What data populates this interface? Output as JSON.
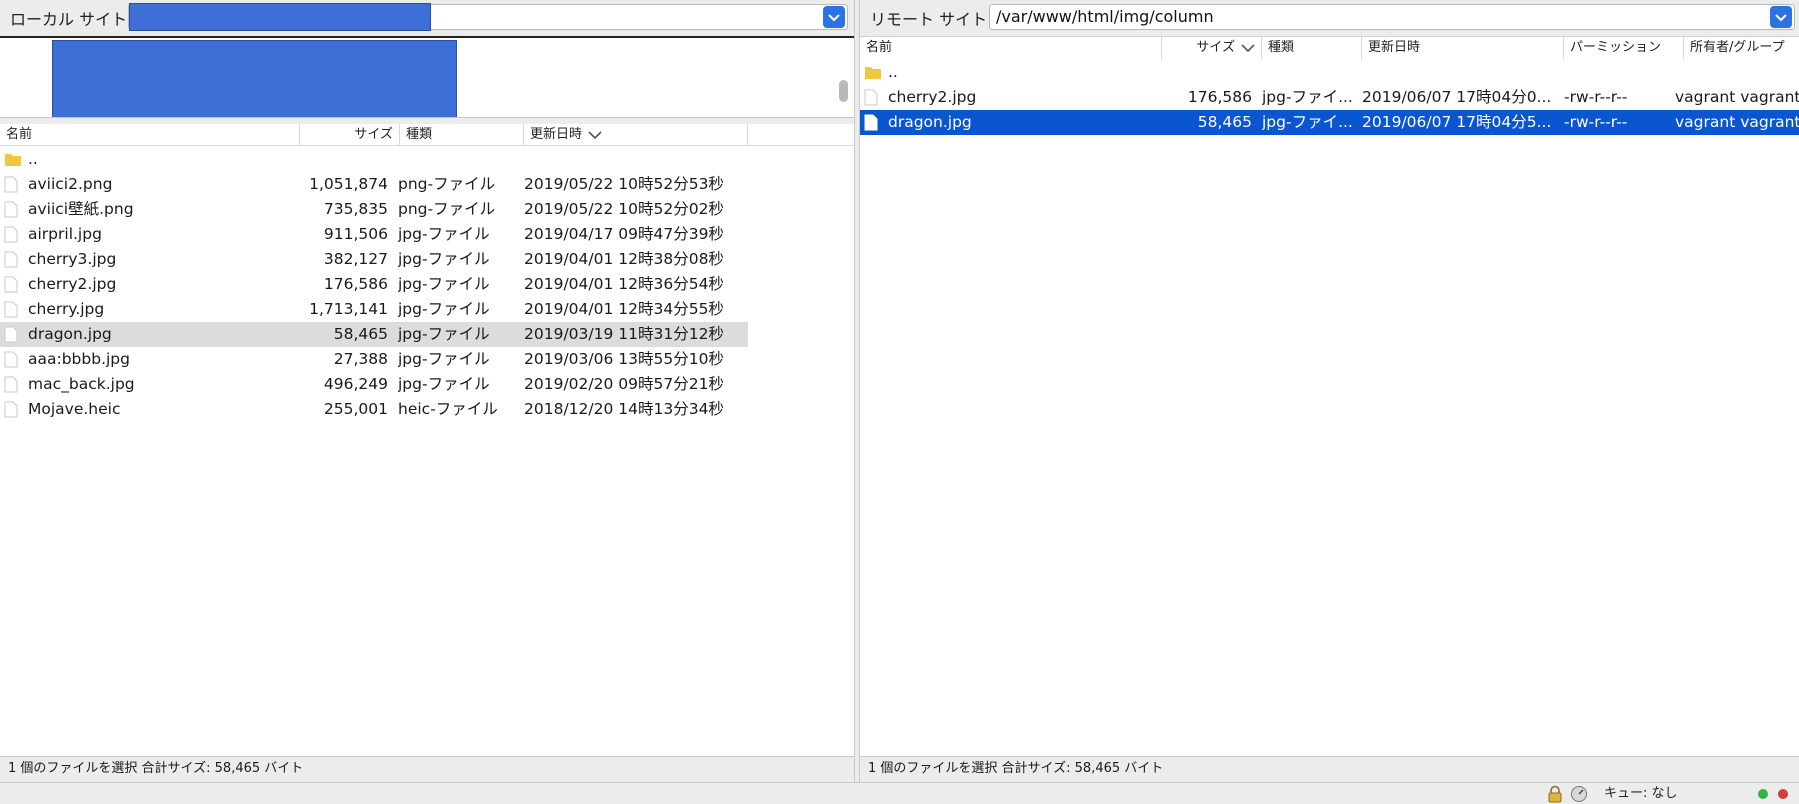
{
  "local": {
    "site_label": "ローカル サイト:",
    "site_value": "",
    "columns": [
      "名前",
      "サイズ",
      "種類",
      "更新日時"
    ],
    "files": [
      {
        "name": "..",
        "size": "",
        "type": "",
        "modified": "",
        "icon": "folder-icon"
      },
      {
        "name": "aviici2.png",
        "size": "1,051,874",
        "type": "png-ファイル",
        "modified": "2019/05/22 10時52分53秒",
        "icon": "file-icon"
      },
      {
        "name": "aviici壁紙.png",
        "size": "735,835",
        "type": "png-ファイル",
        "modified": "2019/05/22 10時52分02秒",
        "icon": "file-icon"
      },
      {
        "name": "airpril.jpg",
        "size": "911,506",
        "type": "jpg-ファイル",
        "modified": "2019/04/17 09時47分39秒",
        "icon": "file-icon"
      },
      {
        "name": "cherry3.jpg",
        "size": "382,127",
        "type": "jpg-ファイル",
        "modified": "2019/04/01 12時38分08秒",
        "icon": "file-icon"
      },
      {
        "name": "cherry2.jpg",
        "size": "176,586",
        "type": "jpg-ファイル",
        "modified": "2019/04/01 12時36分54秒",
        "icon": "file-icon"
      },
      {
        "name": "cherry.jpg",
        "size": "1,713,141",
        "type": "jpg-ファイル",
        "modified": "2019/04/01 12時34分55秒",
        "icon": "file-icon"
      },
      {
        "name": "dragon.jpg",
        "size": "58,465",
        "type": "jpg-ファイル",
        "modified": "2019/03/19 11時31分12秒",
        "icon": "file-icon",
        "selected": true
      },
      {
        "name": "aaa:bbbb.jpg",
        "size": "27,388",
        "type": "jpg-ファイル",
        "modified": "2019/03/06 13時55分10秒",
        "icon": "file-icon"
      },
      {
        "name": "mac_back.jpg",
        "size": "496,249",
        "type": "jpg-ファイル",
        "modified": "2019/02/20 09時57分21秒",
        "icon": "file-icon"
      },
      {
        "name": "Mojave.heic",
        "size": "255,001",
        "type": "heic-ファイル",
        "modified": "2018/12/20 14時13分34秒",
        "icon": "file-icon"
      }
    ],
    "status": "1 個のファイルを選択 合計サイズ: 58,465 バイト"
  },
  "remote": {
    "site_label": "リモート サイト:",
    "site_value": "/var/www/html/img/column",
    "columns": [
      "名前",
      "サイズ",
      "種類",
      "更新日時",
      "パーミッション",
      "所有者/グループ"
    ],
    "files": [
      {
        "name": "..",
        "size": "",
        "type": "",
        "modified": "",
        "perm": "",
        "owner": "",
        "icon": "folder-icon"
      },
      {
        "name": "cherry2.jpg",
        "size": "176,586",
        "type": "jpg-ファイ...",
        "modified": "2019/06/07 17時04分0...",
        "perm": "-rw-r--r--",
        "owner": "vagrant vagrant",
        "icon": "file-icon"
      },
      {
        "name": "dragon.jpg",
        "size": "58,465",
        "type": "jpg-ファイ...",
        "modified": "2019/06/07 17時04分5...",
        "perm": "-rw-r--r--",
        "owner": "vagrant vagrant",
        "icon": "file-icon",
        "selected": true
      }
    ],
    "status": "1 個のファイルを選択 合計サイズ: 58,465 バイト"
  },
  "bottom": {
    "queue": "キュー: なし",
    "icons": [
      "lock-icon",
      "speedometer-icon",
      "green-status-dot",
      "red-status-dot"
    ]
  },
  "colors": {
    "selection_blue": "#0a55d0",
    "selection_gray": "#dcdcdc",
    "folder_yellow": "#f4c542",
    "combo_blue": "#2b73e0"
  }
}
